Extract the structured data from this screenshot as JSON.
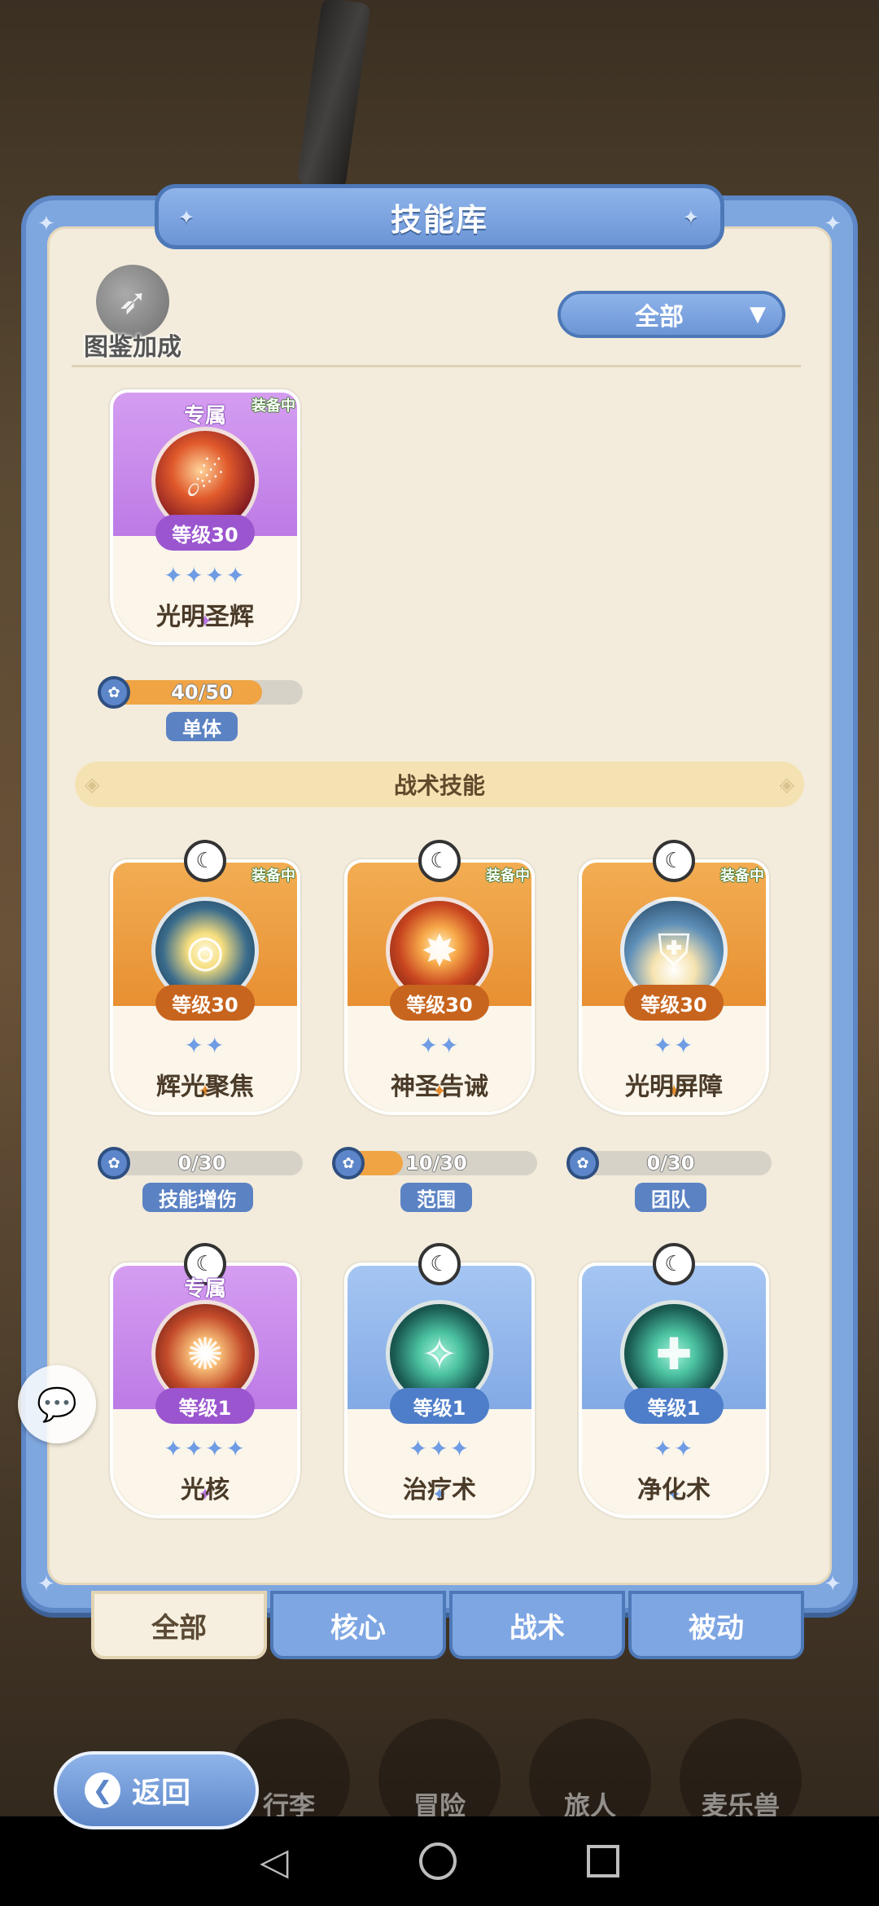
{
  "title": "技能库",
  "dex_bonus_label": "图鉴加成",
  "filter": {
    "selected": "全部",
    "arrow": "▼"
  },
  "section_tactical": "战术技能",
  "core_skill": {
    "exclusive_label": "专属",
    "equipped_label": "装备中",
    "level": "等级30",
    "stars": "✦✦✦✦",
    "name": "光明圣辉",
    "progress_text": "40/50",
    "progress_value": 0.8,
    "tag": "单体"
  },
  "tactical_skills": [
    {
      "equipped_label": "装备中",
      "level": "等级30",
      "stars": "✦✦",
      "name": "辉光聚焦",
      "progress_text": "0/30",
      "progress_value": 0,
      "tag": "技能增伤"
    },
    {
      "equipped_label": "装备中",
      "level": "等级30",
      "stars": "✦✦",
      "name": "神圣告诫",
      "progress_text": "10/30",
      "progress_value": 0.333,
      "tag": "范围"
    },
    {
      "equipped_label": "装备中",
      "level": "等级30",
      "stars": "✦✦",
      "name": "光明屏障",
      "progress_text": "0/30",
      "progress_value": 0,
      "tag": "团队"
    }
  ],
  "other_skills": [
    {
      "exclusive_label": "专属",
      "level": "等级1",
      "stars": "✦✦✦✦",
      "name": "光核"
    },
    {
      "level": "等级1",
      "stars": "✦✦✦",
      "name": "治疗术"
    },
    {
      "level": "等级1",
      "stars": "✦✦",
      "name": "净化术"
    }
  ],
  "tabs": [
    "全部",
    "核心",
    "战术",
    "被动"
  ],
  "bottom_nav": [
    "行李",
    "冒险",
    "旅人",
    "麦乐兽"
  ],
  "back_label": "返回",
  "icons": {
    "moon": "moon-icon",
    "gear": "gear-icon",
    "chat": "chat-icon",
    "back": "back-arrow-icon"
  },
  "colors": {
    "panel_blue": "#7fa7df",
    "card_purple": "#c887ea",
    "card_orange": "#eb9a3e",
    "card_blue": "#94b8ee",
    "inner_bg": "#f3ecdc"
  }
}
